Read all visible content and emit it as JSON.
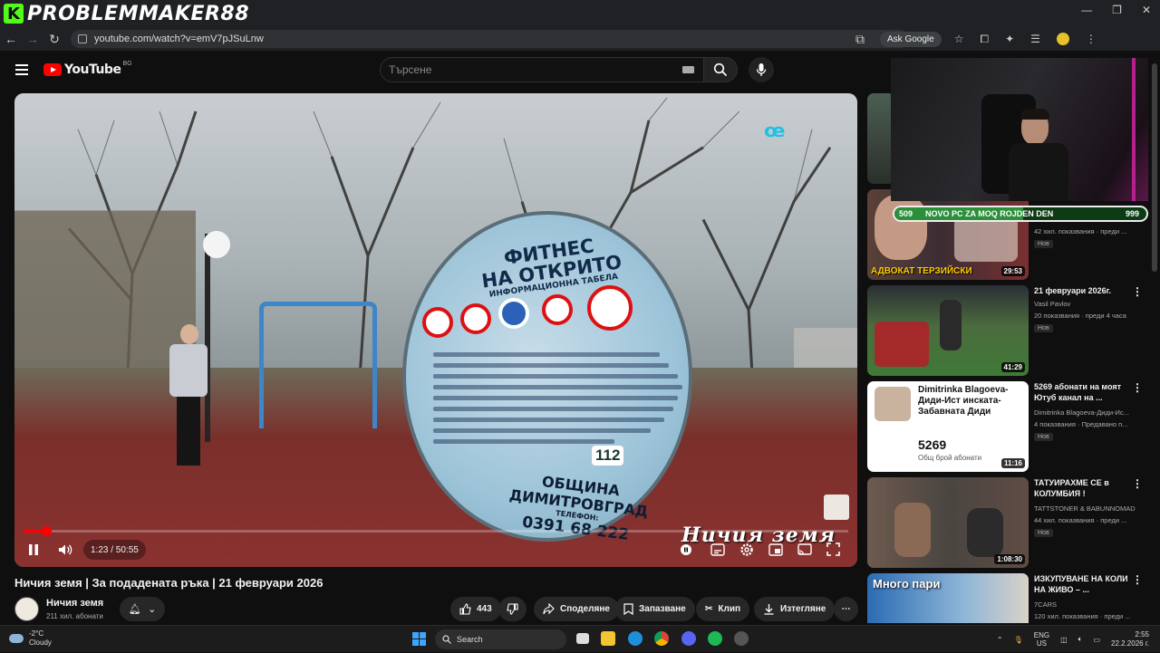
{
  "overlay": {
    "brand_name": "PROBLEMMAKER88",
    "brand_letter": "K"
  },
  "browser": {
    "url": "youtube.com/watch?v=emV7pJSuLnw",
    "ask_label": "Ask Google"
  },
  "masthead": {
    "logo_text": "YouTube",
    "region": "BG",
    "search_placeholder": "Търсене"
  },
  "player": {
    "time": "1:23 / 50:55",
    "progress": 0.027,
    "watermark": "Ничия земя",
    "sign": {
      "title_line1": "ФИТНЕС",
      "title_line2": "НА ОТКРИТО",
      "subtitle": "ИНФОРМАЦИОННА ТАБЕЛА",
      "bottom_line1": "ОБЩИНА",
      "bottom_line2": "ДИМИТРОВГРАД",
      "phone_label": "ТЕЛЕФОН:",
      "phone": "0391 68 222",
      "emergency": "112"
    }
  },
  "video": {
    "title": "Ничия земя | За подадената ръка | 21 февруари 2026",
    "channel": "Ничия земя",
    "subscribers": "211 хил. абонати",
    "likes": "443",
    "share_label": "Споделяне",
    "save_label": "Запазване",
    "clip_label": "Клип",
    "download_label": "Изтегляне"
  },
  "stream": {
    "goal_start": "509",
    "goal_label": "NOVO PC ZA MOQ ROJDEN DEN",
    "goal_end": "999",
    "goal_progress": 0.51
  },
  "recommendations": [
    {
      "title": "",
      "channel": "",
      "meta": "",
      "duration": ""
    },
    {
      "title": "",
      "channel": "",
      "meta": "42 хил. показвания · преди ...",
      "badge": "Нов",
      "duration": "29:53",
      "thumb_text": "АДВОКАТ ТЕРЗИЙСКИ"
    },
    {
      "title": "21 февруари 2026г.",
      "channel": "Vasil Pavlov",
      "meta": "20 показвания · преди 4 часа",
      "badge": "Нов",
      "duration": "41:29"
    },
    {
      "title": "5269 абонати на моят Ютуб канал на ...",
      "channel": "Dimitrinka Blagoeva-Диди-Ис...",
      "meta": "4 показвания · Предавано п...",
      "badge": "Нов",
      "duration": "11:16",
      "card_name": "Dimitrinka Blagoeva-Диди-Ист инската-Забавната Диди",
      "card_count": "5269",
      "card_label": "Общ брой абонати"
    },
    {
      "title": "ТАТУИРАХМЕ СЕ в КОЛУМБИЯ !",
      "channel": "TATTSTONER & BABUNNOMAD",
      "meta": "44 хил. показвания · преди ...",
      "badge": "Нов",
      "duration": "1:08:30"
    },
    {
      "title": "ИЗКУПУВАНЕ НА КОЛИ НА ЖИВО – ...",
      "channel": "7CARS",
      "meta": "120 хил. показвания · преди ...",
      "thumb_text": "Много пари"
    }
  ],
  "taskbar": {
    "temperature": "-2°C",
    "condition": "Cloudy",
    "search": "Search",
    "lang_top": "ENG",
    "lang_bottom": "US",
    "time": "2:55",
    "date": "22.2.2026 г."
  }
}
